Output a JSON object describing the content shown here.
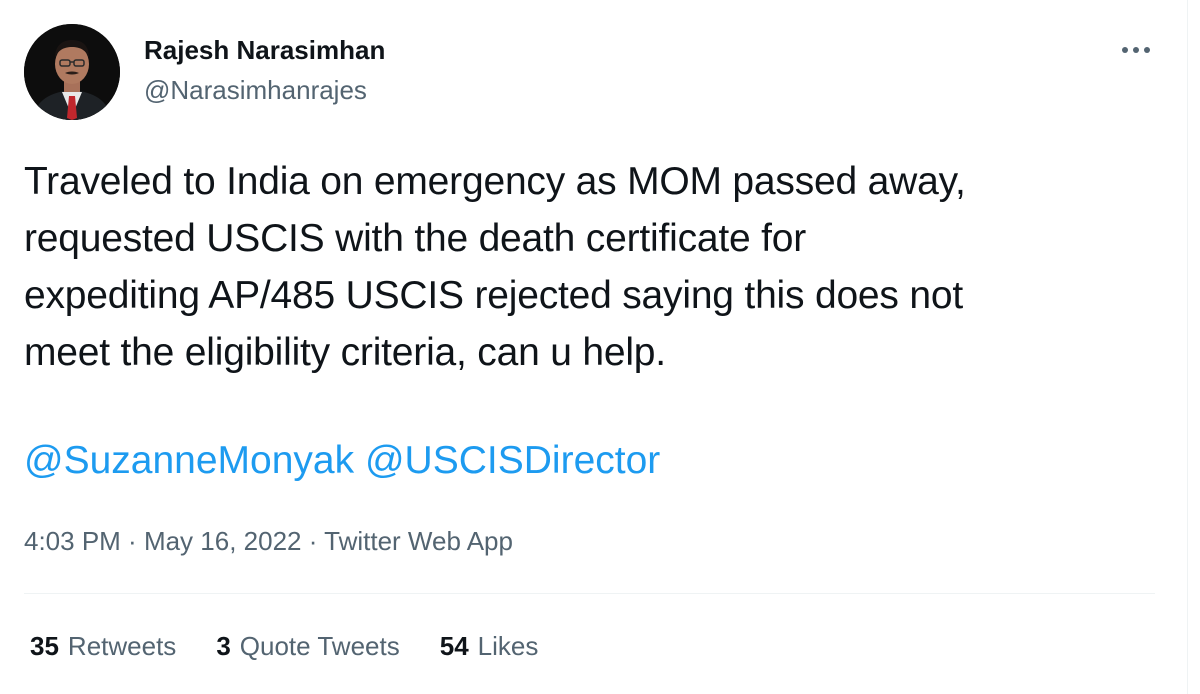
{
  "author": {
    "display_name": "Rajesh Narasimhan",
    "handle": "@Narasimhanrajes"
  },
  "more_icon": "more-dots-icon",
  "tweet": {
    "text_lines": [
      "Traveled to India on emergency as MOM passed away,",
      "requested USCIS with the death certificate for",
      "expediting AP/485 USCIS rejected saying this does not",
      "meet the eligibility criteria, can u help."
    ],
    "mentions": [
      "@SuzanneMonyak",
      "@USCISDirector"
    ]
  },
  "meta": {
    "time": "4:03 PM",
    "separator": " · ",
    "date": "May 16, 2022",
    "source": "Twitter Web App"
  },
  "stats": {
    "retweets_count": "35",
    "retweets_label": "Retweets",
    "quotes_count": "3",
    "quotes_label": "Quote Tweets",
    "likes_count": "54",
    "likes_label": "Likes"
  },
  "colors": {
    "link_blue": "#1d9bf0",
    "secondary_text": "#536471",
    "primary_text": "#0f1419"
  }
}
